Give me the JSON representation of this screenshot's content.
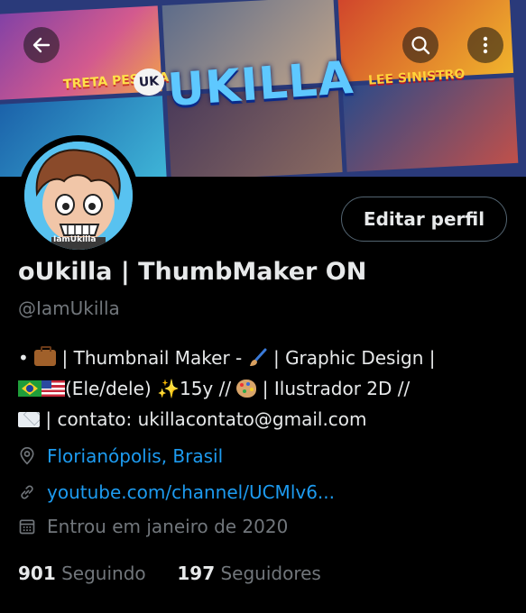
{
  "header": {
    "banner_title": "UKILLA",
    "banner_logo": "UK",
    "banner_tag_left": "TRETA PESADA",
    "banner_tag_right": "LEE SINISTRO",
    "avatar_caption": "IamUkilla",
    "icons": [
      "back-arrow-icon",
      "search-icon",
      "more-vertical-icon"
    ]
  },
  "profile": {
    "edit_button": "Editar perfil",
    "display_name": "oUkilla | ThumbMaker ON",
    "handle": "@IamUkilla",
    "bio": {
      "line1_a": "• ",
      "line1_b": " | Thumbnail Maker - ",
      "line1_c": " | Graphic Design |",
      "line2_a": "(Ele/dele) ",
      "line2_b": "✨",
      "line2_c": "15y // ",
      "line2_d": " | Ilustrador 2D //",
      "line3": " | contato: ukillacontato@gmail.com"
    },
    "location": "Florianópolis, Brasil",
    "website": "youtube.com/channel/UCMlv6...",
    "joined": "Entrou em janeiro de 2020",
    "following_count": "901",
    "following_label": "Seguindo",
    "followers_count": "197",
    "followers_label": "Seguidores"
  },
  "colors": {
    "background": "#000000",
    "text": "#e7e9ea",
    "secondary": "#71767b",
    "link": "#1d9bf0",
    "border": "#536471"
  }
}
